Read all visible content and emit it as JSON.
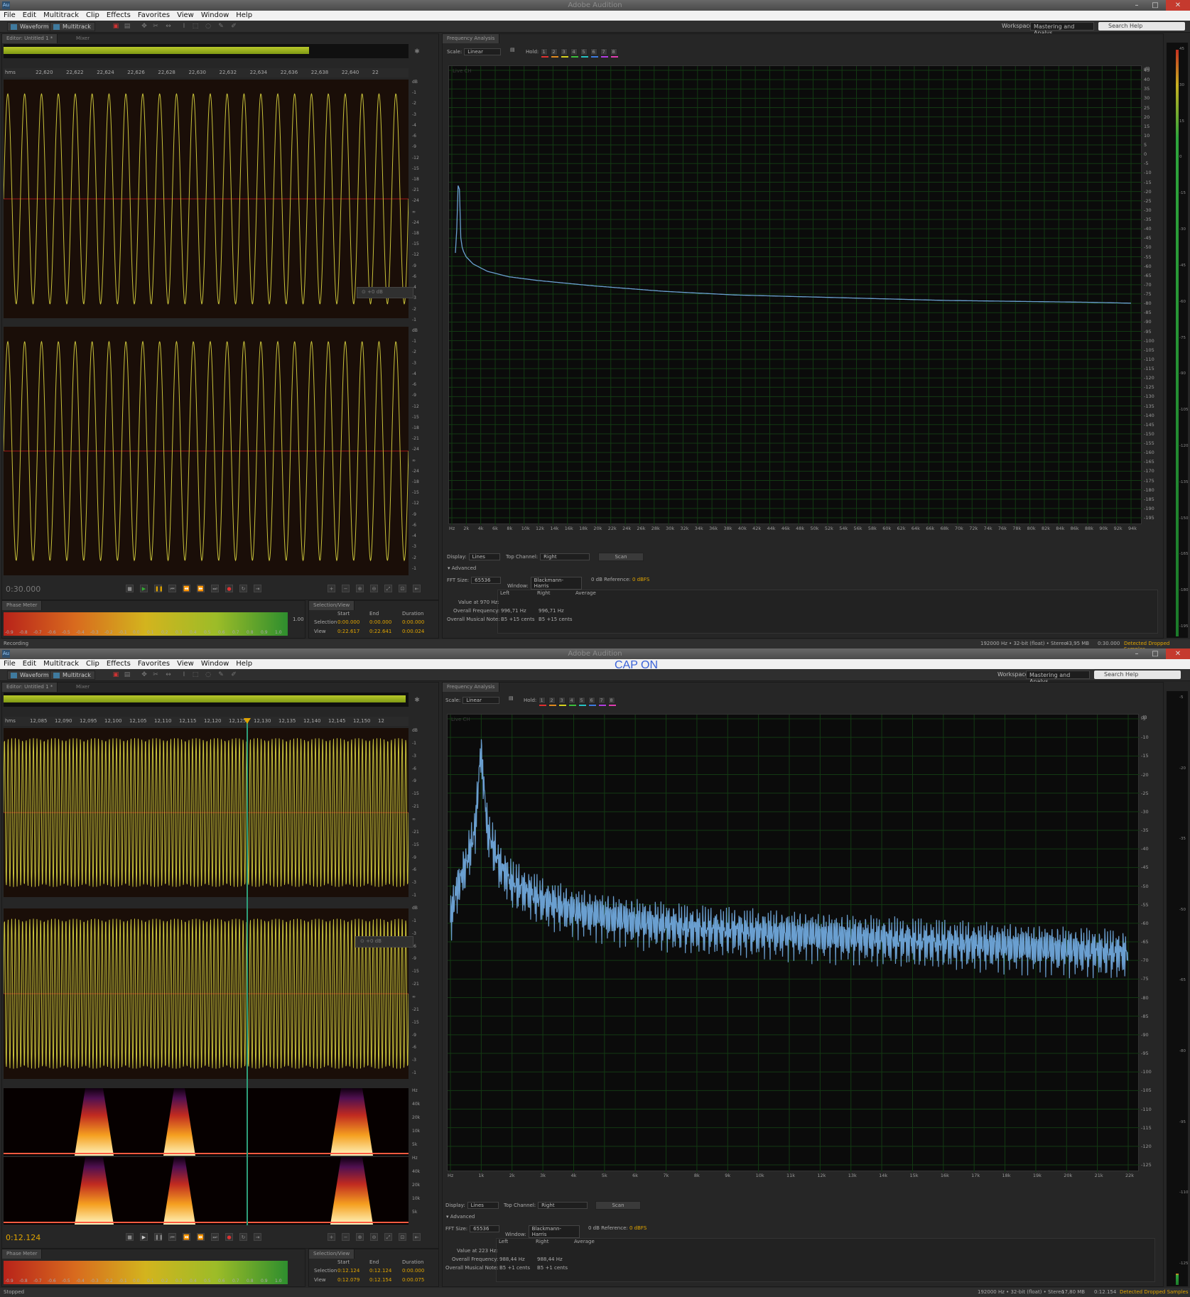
{
  "app": {
    "title": "Adobe Audition",
    "menus": [
      "File",
      "Edit",
      "Multitrack",
      "Clip",
      "Effects",
      "Favorites",
      "View",
      "Window",
      "Help"
    ],
    "waveform_label": "Waveform",
    "multitrack_label": "Multitrack",
    "workspace_label": "Workspace:",
    "workspace_value": "Mastering and Analys...",
    "search_placeholder": "Search Help",
    "editor_tab": "Editor: Untitled 1 *",
    "mixer_tab": "Mixer",
    "fa_tab": "Frequency Analysis",
    "phase_tab": "Phase Meter",
    "selview_tab": "Selection/View",
    "scale_label": "Scale:",
    "scale_value": "Linear",
    "hold_label": "Hold:",
    "hold_buttons": [
      "1",
      "2",
      "3",
      "4",
      "5",
      "6",
      "7",
      "8"
    ],
    "hold_colors": [
      "#e03030",
      "#e08a1e",
      "#d6d21e",
      "#3cbf3c",
      "#26c2c2",
      "#3c7be0",
      "#b03ce0",
      "#e03cb0"
    ],
    "live_label": "Live CH",
    "display_label": "Display:",
    "display_value": "Lines",
    "topch_label": "Top Channel:",
    "topch_value": "Right",
    "scan_label": "Scan",
    "advanced_label": "Advanced",
    "fft_label": "FFT Size:",
    "fft_value": "65536",
    "window_label": "Window:",
    "window_value": "Blackmann-Harris",
    "ref_label": "0 dB Reference:",
    "ref_value": "0 dBFS",
    "stats_cols": [
      "Left",
      "Right",
      "Average"
    ],
    "phase_ticks": [
      "-0.9",
      "-0.8",
      "-0.7",
      "-0.6",
      "-0.5",
      "-0.4",
      "-0.3",
      "-0.2",
      "-0.1",
      "0.0",
      "0.1",
      "0.2",
      "0.3",
      "0.4",
      "0.5",
      "0.6",
      "0.7",
      "0.8",
      "0.9",
      "1.0"
    ],
    "sv_headers": [
      "Start",
      "End",
      "Duration"
    ],
    "sv_rows": [
      "Selection",
      "View"
    ],
    "hz_unit": "hms",
    "db_unit": "dB",
    "accent": "#e0a400",
    "wave_color": "#c8c23a",
    "spectrum_color": "#6a9fd0"
  },
  "top": {
    "ruler": [
      "22,620",
      "22,622",
      "22,624",
      "22,626",
      "22,628",
      "22,630",
      "22,632",
      "22,634",
      "22,636",
      "22,638",
      "22,640",
      "22"
    ],
    "db_labels": [
      "dB",
      "-1",
      "-2",
      "-3",
      "-4",
      "-6",
      "-9",
      "-12",
      "-15",
      "-18",
      "-21",
      "-24",
      "∞",
      "-24",
      "-18",
      "-15",
      "-12",
      "-9",
      "-6",
      "-4",
      "-3",
      "-2",
      "-1"
    ],
    "time": "0:30.000",
    "phase_value": "1.00",
    "selection": {
      "start": "0:00.000",
      "end": "0:00.000",
      "duration": "0:00.000"
    },
    "view": {
      "start": "0:22.617",
      "end": "0:22.641",
      "duration": "0:00.024"
    },
    "x_ticks": [
      "Hz",
      "2k",
      "4k",
      "6k",
      "8k",
      "10k",
      "12k",
      "14k",
      "16k",
      "18k",
      "20k",
      "22k",
      "24k",
      "26k",
      "28k",
      "30k",
      "32k",
      "34k",
      "36k",
      "38k",
      "40k",
      "42k",
      "44k",
      "46k",
      "48k",
      "50k",
      "52k",
      "54k",
      "56k",
      "58k",
      "60k",
      "62k",
      "64k",
      "66k",
      "68k",
      "70k",
      "72k",
      "74k",
      "76k",
      "78k",
      "80k",
      "82k",
      "84k",
      "86k",
      "88k",
      "90k",
      "92k",
      "94k"
    ],
    "y_ticks": [
      "dB",
      "45",
      "40",
      "35",
      "30",
      "25",
      "20",
      "15",
      "10",
      "5",
      "0",
      "-5",
      "-10",
      "-15",
      "-20",
      "-25",
      "-30",
      "-35",
      "-40",
      "-45",
      "-50",
      "-55",
      "-60",
      "-65",
      "-70",
      "-75",
      "-80",
      "-85",
      "-90",
      "-95",
      "-100",
      "-105",
      "-110",
      "-115",
      "-120",
      "-125",
      "-130",
      "-135",
      "-140",
      "-145",
      "-150",
      "-155",
      "-160",
      "-165",
      "-170",
      "-175",
      "-180",
      "-185",
      "-190",
      "-195"
    ],
    "value_label": "Value at 970 Hz:",
    "overall_freq_label": "Overall Frequency:",
    "overall_freq_left": "996,71 Hz",
    "overall_freq_right": "996,71 Hz",
    "musical_label": "Overall Musical Note:",
    "musical_left": "B5 +15 cents",
    "musical_right": "B5 +15 cents",
    "status_left": "Recording",
    "status_right": "192000 Hz • 32-bit (float) • Stereo",
    "status_size": "43,95 MB",
    "status_dur": "0:30.000",
    "status_warn": "Detected Dropped Samples",
    "chart_data": {
      "type": "line",
      "xlabel": "Hz",
      "ylabel": "dB",
      "xlim": [
        0,
        96000
      ],
      "ylim": [
        -195,
        50
      ],
      "series": [
        {
          "x": [
            500,
            800,
            970,
            1200,
            1500,
            2000,
            3000,
            5000,
            8000,
            12000,
            20000,
            30000,
            40000,
            50000,
            60000,
            70000,
            80000,
            90000,
            96000
          ],
          "y": [
            -50,
            -30,
            5,
            -40,
            -48,
            -52,
            -56,
            -60,
            -63,
            -65,
            -68,
            -71,
            -73,
            -74,
            -75,
            -76,
            -76.5,
            -77,
            -77.5
          ]
        }
      ]
    }
  },
  "bottom": {
    "ruler": [
      "hms",
      "12,085",
      "12,090",
      "12,095",
      "12,100",
      "12,105",
      "12,110",
      "12,115",
      "12,120",
      "12,125",
      "12,130",
      "12,135",
      "12,140",
      "12,145",
      "12,150",
      "12"
    ],
    "db_labels": [
      "dB",
      "-1",
      "-3",
      "-6",
      "-9",
      "-15",
      "-21",
      "∞",
      "-21",
      "-15",
      "-9",
      "-6",
      "-3",
      "-1"
    ],
    "spec_labels": [
      "Hz",
      "40k",
      "20k",
      "10k",
      "5k"
    ],
    "time": "0:12.124",
    "caption": "CAP ON",
    "selection": {
      "start": "0:12.124",
      "end": "0:12.124",
      "duration": "0:00.000"
    },
    "view": {
      "start": "0:12.079",
      "end": "0:12.154",
      "duration": "0:00.075"
    },
    "x_ticks": [
      "Hz",
      "1k",
      "2k",
      "3k",
      "4k",
      "5k",
      "6k",
      "7k",
      "8k",
      "9k",
      "10k",
      "11k",
      "12k",
      "13k",
      "14k",
      "15k",
      "16k",
      "17k",
      "18k",
      "19k",
      "20k",
      "21k",
      "22k"
    ],
    "y_ticks": [
      "dB",
      "-5",
      "-10",
      "-15",
      "-20",
      "-25",
      "-30",
      "-35",
      "-40",
      "-45",
      "-50",
      "-55",
      "-60",
      "-65",
      "-70",
      "-75",
      "-80",
      "-85",
      "-90",
      "-95",
      "-100",
      "-105",
      "-110",
      "-115",
      "-120",
      "-125"
    ],
    "value_label": "Value at 223 Hz:",
    "overall_freq_label": "Overall Frequency:",
    "overall_freq_left": "988,44 Hz",
    "overall_freq_right": "988,44 Hz",
    "musical_label": "Overall Musical Note:",
    "musical_left": "B5 +1 cents",
    "musical_right": "B5 +1 cents",
    "status_left": "Stopped",
    "status_right": "192000 Hz • 32-bit (float) • Stereo",
    "status_size": "17,80 MB",
    "status_dur": "0:12.154",
    "status_warn": "Detected Dropped Samples",
    "chart_data": {
      "type": "line",
      "xlabel": "Hz",
      "ylabel": "dB",
      "xlim": [
        0,
        22000
      ],
      "ylim": [
        -127,
        0
      ],
      "series": [
        {
          "x": [
            0,
            200,
            500,
            800,
            988,
            1200,
            1600,
            2000,
            3000,
            4000,
            6000,
            8000,
            10000,
            12000,
            14000,
            16000,
            18000,
            20000,
            22000
          ],
          "y": [
            -55,
            -47,
            -40,
            -30,
            -7,
            -30,
            -40,
            -45,
            -50,
            -53,
            -56,
            -58,
            -59,
            -60,
            -61,
            -62,
            -63,
            -64,
            -65
          ]
        }
      ]
    }
  }
}
